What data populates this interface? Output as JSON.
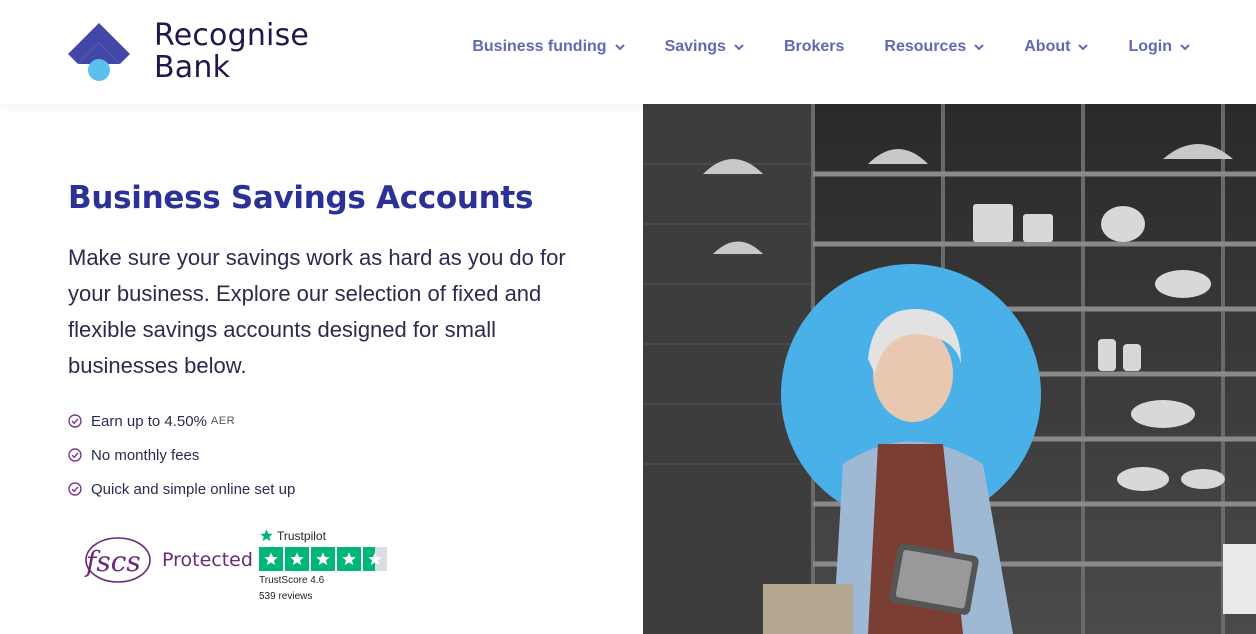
{
  "brand": {
    "line1": "Recognise",
    "line2": "Bank",
    "colors": {
      "primary": "#4247a8",
      "accent": "#5bc0eb",
      "text": "#1c1a4a"
    }
  },
  "nav": {
    "items": [
      {
        "label": "Business funding",
        "dropdown": true
      },
      {
        "label": "Savings",
        "dropdown": true
      },
      {
        "label": "Brokers",
        "dropdown": false
      },
      {
        "label": "Resources",
        "dropdown": true
      },
      {
        "label": "About",
        "dropdown": true
      },
      {
        "label": "Login",
        "dropdown": true
      }
    ],
    "color": "#6269b3"
  },
  "hero": {
    "title": "Business Savings Accounts",
    "intro": "Make sure your savings work as hard as you do for your business. Explore our selection of fixed and flexible savings accounts designed for small businesses below.",
    "features": [
      {
        "text": "Earn up to 4.50%",
        "suffix": "AER"
      },
      {
        "text": "No monthly fees"
      },
      {
        "text": "Quick and simple online set up"
      }
    ],
    "icon": "check-circle-icon"
  },
  "badges": {
    "fscs": {
      "logo_text": "fscs",
      "label": "Protected",
      "color": "#6a2a7a"
    },
    "trustpilot": {
      "brand": "Trustpilot",
      "score_text": "TrustScore 4.6",
      "reviews_text": "539 reviews",
      "rating": 4.5,
      "star_color": "#00b67a"
    }
  },
  "image": {
    "description_icon": "photo",
    "accent_circle": "#4ab0e8"
  }
}
